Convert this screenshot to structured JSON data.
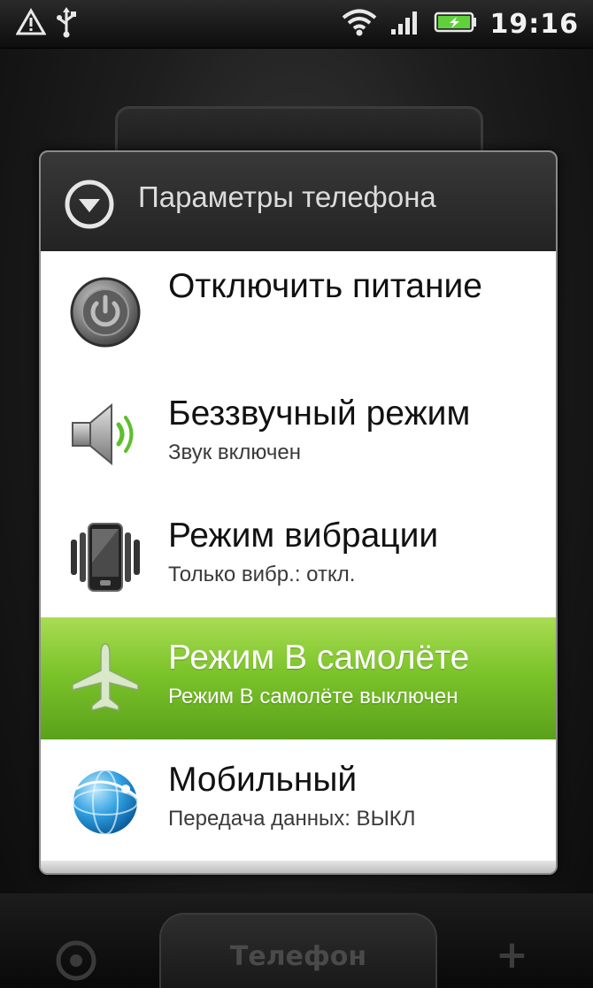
{
  "status_bar": {
    "time": "19:16",
    "icons": [
      "warning-icon",
      "usb-icon",
      "wifi-icon",
      "signal-icon",
      "battery-icon"
    ]
  },
  "dialog": {
    "title": "Параметры телефона",
    "items": [
      {
        "title": "Отключить питание",
        "subtitle": "",
        "icon": "power-icon"
      },
      {
        "title": "Беззвучный режим",
        "subtitle": "Звук включен",
        "icon": "speaker-icon"
      },
      {
        "title": "Режим вибрации",
        "subtitle": "Только вибр.: откл.",
        "icon": "vibrate-icon"
      },
      {
        "title": "Режим В самолёте",
        "subtitle": "Режим В самолёте выключен",
        "icon": "airplane-icon",
        "selected": true
      },
      {
        "title": "Мобильный",
        "subtitle": "Передача данных: ВЫКЛ",
        "icon": "globe-icon"
      }
    ]
  },
  "dock": {
    "phone_label": "Телефон"
  },
  "colors": {
    "highlight": "#7cc42a",
    "header_bg": "#2d2d2d"
  }
}
